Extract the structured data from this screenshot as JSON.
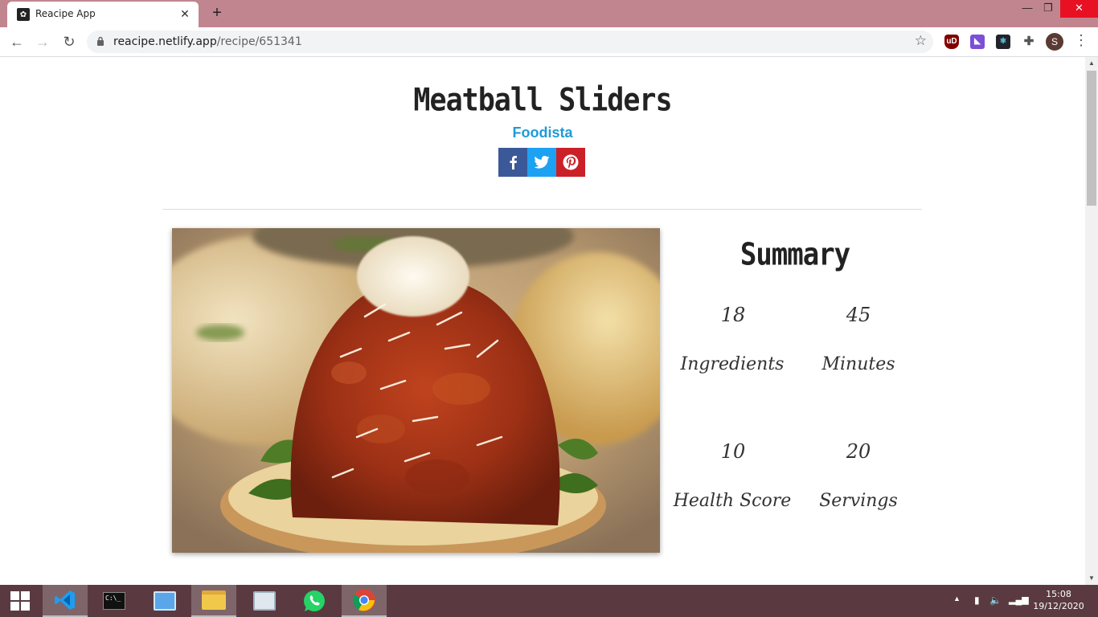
{
  "browser": {
    "tab_title": "Reacipe App",
    "url_domain": "reacipe.netlify.app",
    "url_path": "/recipe/651341",
    "avatar_letter": "S",
    "accent_color": "#c1858f"
  },
  "recipe": {
    "title": "Meatball Sliders",
    "source": "Foodista",
    "share": [
      {
        "name": "facebook",
        "color": "#3b5998"
      },
      {
        "name": "twitter",
        "color": "#1da1f2"
      },
      {
        "name": "pinterest",
        "color": "#cb2027"
      }
    ]
  },
  "summary": {
    "title": "Summary",
    "stats": [
      {
        "value": "18",
        "label": "Ingredients"
      },
      {
        "value": "45",
        "label": "Minutes"
      },
      {
        "value": "10",
        "label": "Health Score"
      },
      {
        "value": "20",
        "label": "Servings"
      }
    ]
  },
  "taskbar": {
    "time": "15:08",
    "date": "19/12/2020"
  }
}
